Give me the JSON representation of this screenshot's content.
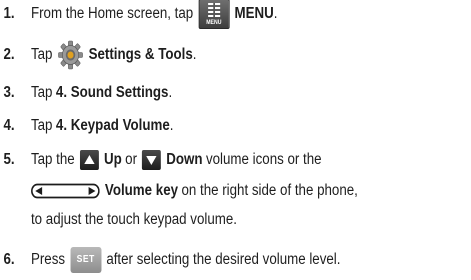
{
  "steps": [
    {
      "number": "1.",
      "pre": "From the Home screen, tap",
      "icon": "menu-icon",
      "icon_caption": "MENU",
      "bold": "MENU",
      "post": "."
    },
    {
      "number": "2.",
      "pre": "Tap",
      "icon": "settings-gear-icon",
      "bold": "Settings & Tools",
      "post": "."
    },
    {
      "number": "3.",
      "pre": "Tap",
      "bold": "4. Sound Settings",
      "post": "."
    },
    {
      "number": "4.",
      "pre": "Tap",
      "bold": "4. Keypad Volume",
      "post": "."
    },
    {
      "number": "5.",
      "pre": "Tap the",
      "up_icon": "up-arrow-icon",
      "up_label": "Up",
      "or_text": "or",
      "down_icon": "down-arrow-icon",
      "down_label": "Down",
      "mid_text": "volume icons or the",
      "volume_icon": "volume-key-icon",
      "volume_label": "Volume key",
      "line2_post": "on the right side of the phone,",
      "line3": "to adjust the touch keypad volume."
    },
    {
      "number": "6.",
      "pre": "Press",
      "icon": "set-button-icon",
      "icon_caption": "SET",
      "post": "after selecting the desired volume level."
    }
  ],
  "colors": {
    "text": "#1e1e1e",
    "icon_dark": "#1c1c1c",
    "set_button": "#a3a3a3"
  }
}
